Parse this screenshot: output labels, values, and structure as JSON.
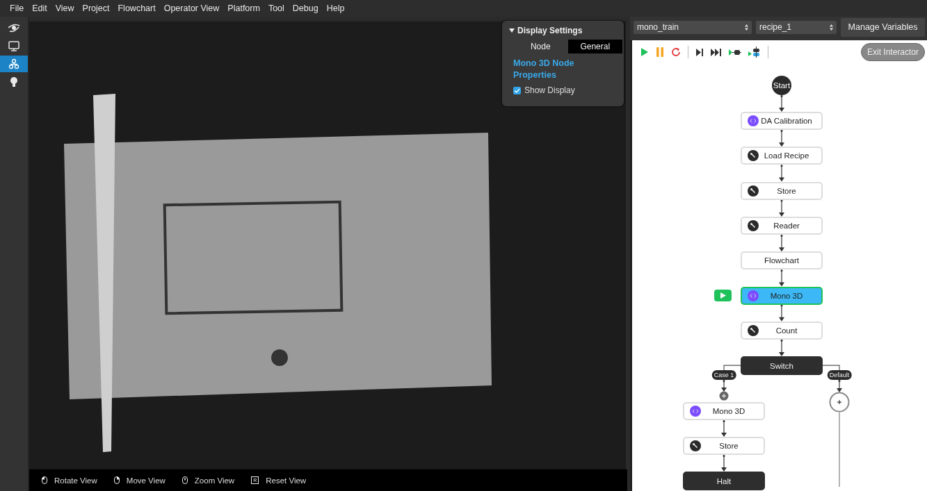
{
  "menu": [
    "File",
    "Edit",
    "View",
    "Project",
    "Flowchart",
    "Operator View",
    "Platform",
    "Tool",
    "Debug",
    "Help"
  ],
  "sidebar": {
    "items": [
      {
        "kind": "eye",
        "selected": false
      },
      {
        "kind": "monitor",
        "selected": false
      },
      {
        "kind": "flow",
        "selected": true
      },
      {
        "kind": "bulb",
        "selected": false
      }
    ]
  },
  "display_settings": {
    "title": "Display Settings",
    "expanded": true,
    "tabs": [
      {
        "label": "Node",
        "selected": false
      },
      {
        "label": "General",
        "selected": true
      }
    ],
    "heading": "Mono 3D Node Properties",
    "show_display": {
      "label": "Show Display",
      "checked": true
    }
  },
  "view_hints": [
    {
      "kind": "left-click",
      "label": "Rotate View"
    },
    {
      "kind": "right-click",
      "label": "Move View"
    },
    {
      "kind": "wheel",
      "label": "Zoom View"
    },
    {
      "kind": "key",
      "key": "R",
      "label": "Reset View"
    }
  ],
  "flow_selectors": [
    {
      "value": "mono_train"
    },
    {
      "value": "recipe_1"
    }
  ],
  "manage_button": "Manage Variables",
  "exit_button": "Exit Interactor",
  "flowchart": {
    "start": "Start",
    "main": [
      {
        "kind": "script",
        "label": "DA Calibration",
        "selected": false
      },
      {
        "kind": "tool",
        "label": "Load Recipe",
        "selected": false
      },
      {
        "kind": "tool",
        "label": "Store",
        "selected": false
      },
      {
        "kind": "tool",
        "label": "Reader",
        "selected": false
      },
      {
        "kind": "plain",
        "label": "Flowchart",
        "selected": false
      },
      {
        "kind": "script",
        "label": "Mono 3D",
        "selected": true
      },
      {
        "kind": "tool",
        "label": "Count",
        "selected": false
      },
      {
        "kind": "switch",
        "label": "Switch"
      }
    ],
    "cases": [
      {
        "label": "Case 1",
        "children": [
          {
            "kind": "script",
            "label": "Mono 3D",
            "selected": false
          },
          {
            "kind": "tool",
            "label": "Store",
            "selected": false
          },
          {
            "kind": "terminal",
            "label": "Halt"
          }
        ]
      },
      {
        "label": "Default"
      }
    ]
  }
}
